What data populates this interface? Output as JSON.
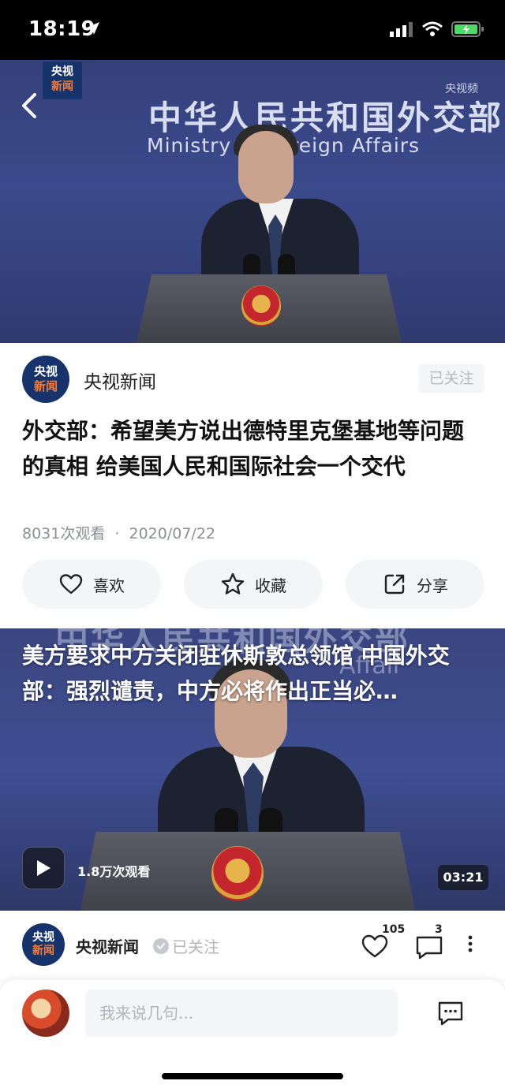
{
  "status_bar": {
    "time": "18:19"
  },
  "hero": {
    "backdrop_cn": "中华人民共和国外交部",
    "backdrop_en": "Ministry of Foreign Affairs",
    "logo_line1": "央视",
    "logo_line2": "新闻",
    "watermark": "央视频"
  },
  "channel": {
    "avatar_line1": "央视",
    "avatar_line2": "新闻",
    "name": "央视新闻",
    "follow_label": "已关注"
  },
  "article": {
    "title": "外交部：希望美方说出德特里克堡基地等问题的真相 给美国人民和国际社会一个交代",
    "views": "8031次观看",
    "separator": "·",
    "date": "2020/07/22"
  },
  "actions": {
    "like_label": "喜欢",
    "favorite_label": "收藏",
    "share_label": "分享"
  },
  "video2": {
    "title": "美方要求中方关闭驻休斯敦总领馆 中国外交部：强烈谴责，中方必将作出正当必…",
    "views": "1.8万次观看",
    "duration": "03:21",
    "backdrop_text": "中华人民共和国外交部",
    "backdrop_en": "Affair"
  },
  "row2": {
    "avatar_line1": "央视",
    "avatar_line2": "新闻",
    "name": "央视新闻",
    "follow_label": "已关注",
    "like_count": "105",
    "comment_count": "3"
  },
  "comment_bar": {
    "placeholder": "我来说几句..."
  },
  "colors": {
    "brand_navy": "#17336b",
    "brand_orange": "#ff7a2e",
    "backdrop_blue": "#3b4a8c"
  }
}
